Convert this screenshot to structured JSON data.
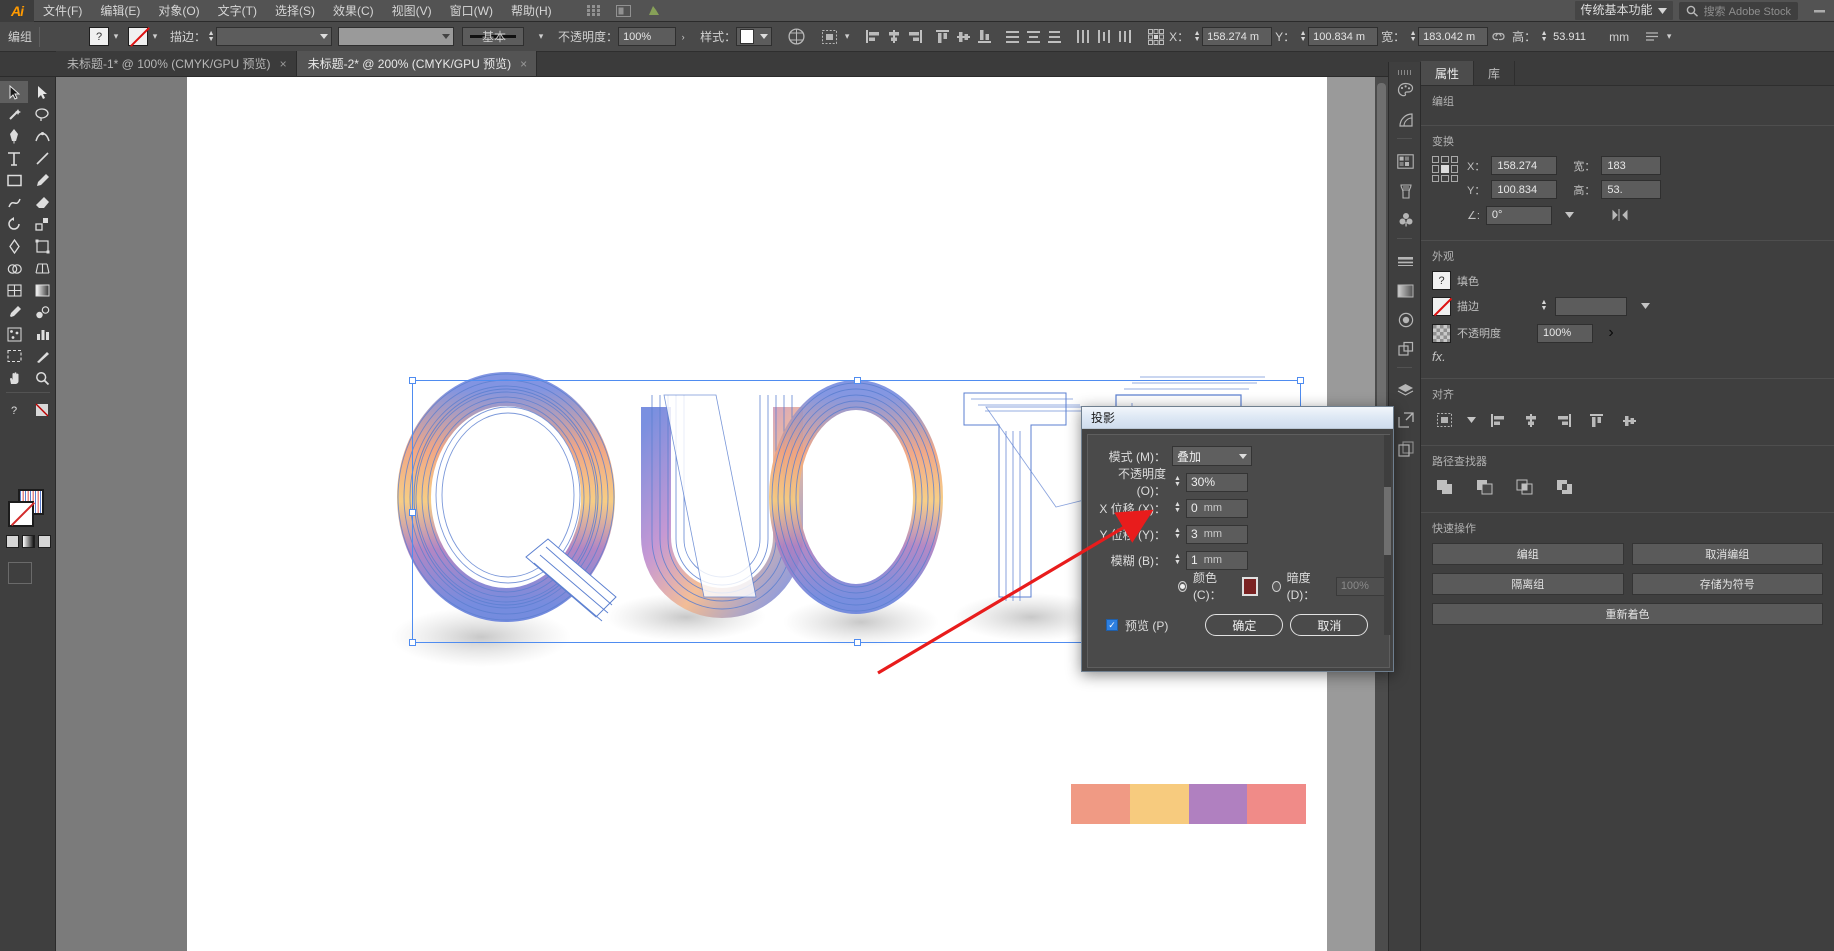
{
  "app": {
    "name": "Ai",
    "workspace": "传统基本功能",
    "stock_placeholder": "搜索 Adobe Stock"
  },
  "menu": {
    "items": [
      {
        "label": "文件(F)"
      },
      {
        "label": "编辑(E)"
      },
      {
        "label": "对象(O)"
      },
      {
        "label": "文字(T)"
      },
      {
        "label": "选择(S)"
      },
      {
        "label": "效果(C)"
      },
      {
        "label": "视图(V)"
      },
      {
        "label": "窗口(W)"
      },
      {
        "label": "帮助(H)"
      }
    ]
  },
  "control_bar": {
    "selection_label": "编组",
    "fill_label": "?",
    "stroke_label": "描边：",
    "stroke_weight": "",
    "stroke_profile": "",
    "brush_label": "基本",
    "opacity_label": "不透明度：",
    "opacity_value": "100%",
    "style_label": "样式：",
    "x_label": "X：",
    "x_value": "158.274 m",
    "y_label": "Y：",
    "y_value": "100.834 m",
    "w_label": "宽：",
    "w_value": "183.042 m",
    "h_label": "高：",
    "h_value": "53.911",
    "unit": "mm"
  },
  "tabs": [
    {
      "label": "未标题-1* @ 100% (CMYK/GPU 预览)",
      "active": false,
      "close": "×"
    },
    {
      "label": "未标题-2* @ 200% (CMYK/GPU 预览)",
      "active": true,
      "close": "×"
    }
  ],
  "toolbox": {
    "tools": [
      {
        "name": "selection-tool"
      },
      {
        "name": "direct-selection-tool"
      },
      {
        "name": "magic-wand-tool"
      },
      {
        "name": "lasso-tool"
      },
      {
        "name": "pen-tool"
      },
      {
        "name": "curvature-tool"
      },
      {
        "name": "type-tool"
      },
      {
        "name": "line-segment-tool"
      },
      {
        "name": "rectangle-tool"
      },
      {
        "name": "paintbrush-tool"
      },
      {
        "name": "shaper-tool"
      },
      {
        "name": "eraser-tool"
      },
      {
        "name": "rotate-tool"
      },
      {
        "name": "scale-tool"
      },
      {
        "name": "width-tool"
      },
      {
        "name": "free-transform-tool"
      },
      {
        "name": "shape-builder-tool"
      },
      {
        "name": "perspective-grid-tool"
      },
      {
        "name": "mesh-tool"
      },
      {
        "name": "gradient-tool"
      },
      {
        "name": "eyedropper-tool"
      },
      {
        "name": "blend-tool"
      },
      {
        "name": "symbol-sprayer-tool"
      },
      {
        "name": "column-graph-tool"
      },
      {
        "name": "artboard-tool"
      },
      {
        "name": "slice-tool"
      },
      {
        "name": "hand-tool"
      },
      {
        "name": "zoom-tool"
      }
    ]
  },
  "canvas": {
    "artwork_text": "QUOTE",
    "palette_colors": [
      "#f09a84",
      "#f7cb7e",
      "#b080c0",
      "#f08b88"
    ],
    "selection_color": "#4f8cf0"
  },
  "properties_panel": {
    "tabs": [
      {
        "label": "属性",
        "active": true
      },
      {
        "label": "库",
        "active": false
      }
    ],
    "selection": {
      "title": "编组"
    },
    "transform": {
      "title": "变换",
      "x_label": "X：",
      "x_value": "158.274",
      "y_label": "Y：",
      "y_value": "100.834",
      "w_label": "宽：",
      "w_value": "183",
      "h_label": "高：",
      "h_value": "53.",
      "angle_label": "∠:",
      "angle_value": "0°"
    },
    "appearance": {
      "title": "外观",
      "fill_label": "填色",
      "stroke_label": "描边",
      "opacity_label": "不透明度",
      "opacity_value": "100%",
      "fx_label": "fx."
    },
    "align": {
      "title": "对齐"
    },
    "pathfinder": {
      "title": "路径查找器"
    },
    "quick_actions": {
      "title": "快速操作",
      "buttons": [
        "编组",
        "取消编组",
        "隔离组",
        "存储为符号",
        "重新着色"
      ]
    }
  },
  "dialog": {
    "title": "投影",
    "mode_label": "模式 (M)：",
    "mode_value": "叠加",
    "opacity_label": "不透明度 (O)：",
    "opacity_value": "30%",
    "x_offset_label": "X 位移 (X)：",
    "x_offset_value": "0",
    "y_offset_label": "Y 位移 (Y)：",
    "y_offset_value": "3",
    "blur_label": "模糊 (B)：",
    "blur_value": "1",
    "unit": "mm",
    "color_label": "颜色 (C)：",
    "color_value": "#7a2222",
    "darkness_label": "暗度 (D)：",
    "darkness_value": "100%",
    "preview_label": "预览 (P)",
    "ok_label": "确定",
    "cancel_label": "取消"
  }
}
